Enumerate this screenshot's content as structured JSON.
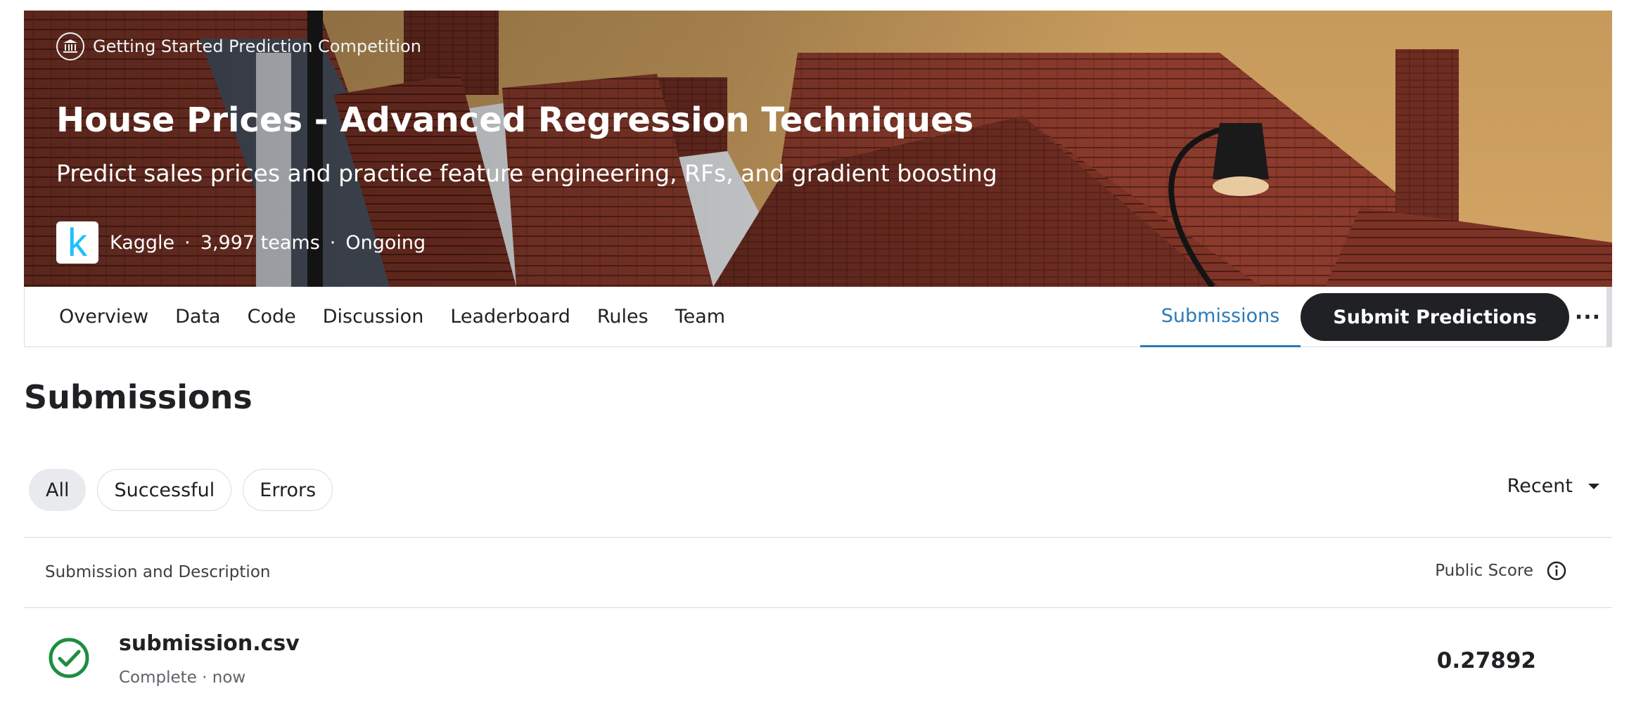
{
  "hero": {
    "tag": "Getting Started Prediction Competition",
    "title": "House Prices - Advanced Regression Techniques",
    "subtitle": "Predict sales prices and practice feature engineering, RFs, and gradient boosting",
    "logo_letter": "k",
    "host": "Kaggle",
    "teams": "3,997 teams",
    "status": "Ongoing",
    "separator": "·"
  },
  "tabs": {
    "items": [
      {
        "label": "Overview"
      },
      {
        "label": "Data"
      },
      {
        "label": "Code"
      },
      {
        "label": "Discussion"
      },
      {
        "label": "Leaderboard"
      },
      {
        "label": "Rules"
      },
      {
        "label": "Team"
      }
    ],
    "active_label": "Submissions",
    "submit_label": "Submit Predictions",
    "more_label": "···"
  },
  "page": {
    "title": "Submissions"
  },
  "filters": {
    "chips": [
      {
        "label": "All",
        "active": true
      },
      {
        "label": "Successful",
        "active": false
      },
      {
        "label": "Errors",
        "active": false
      }
    ],
    "sort_label": "Recent"
  },
  "table": {
    "header_left": "Submission and Description",
    "header_right": "Public Score",
    "rows": [
      {
        "file": "submission.csv",
        "status": "Complete · now",
        "score": "0.27892"
      }
    ]
  },
  "colors": {
    "accent": "#2a7ab8",
    "success": "#1e8e3e",
    "primary_button": "#202124",
    "kaggle_blue": "#20beff"
  },
  "icons": {
    "tag": "bank-icon",
    "info": "info-icon",
    "status": "check-circle-icon",
    "sort": "caret-down-icon"
  }
}
